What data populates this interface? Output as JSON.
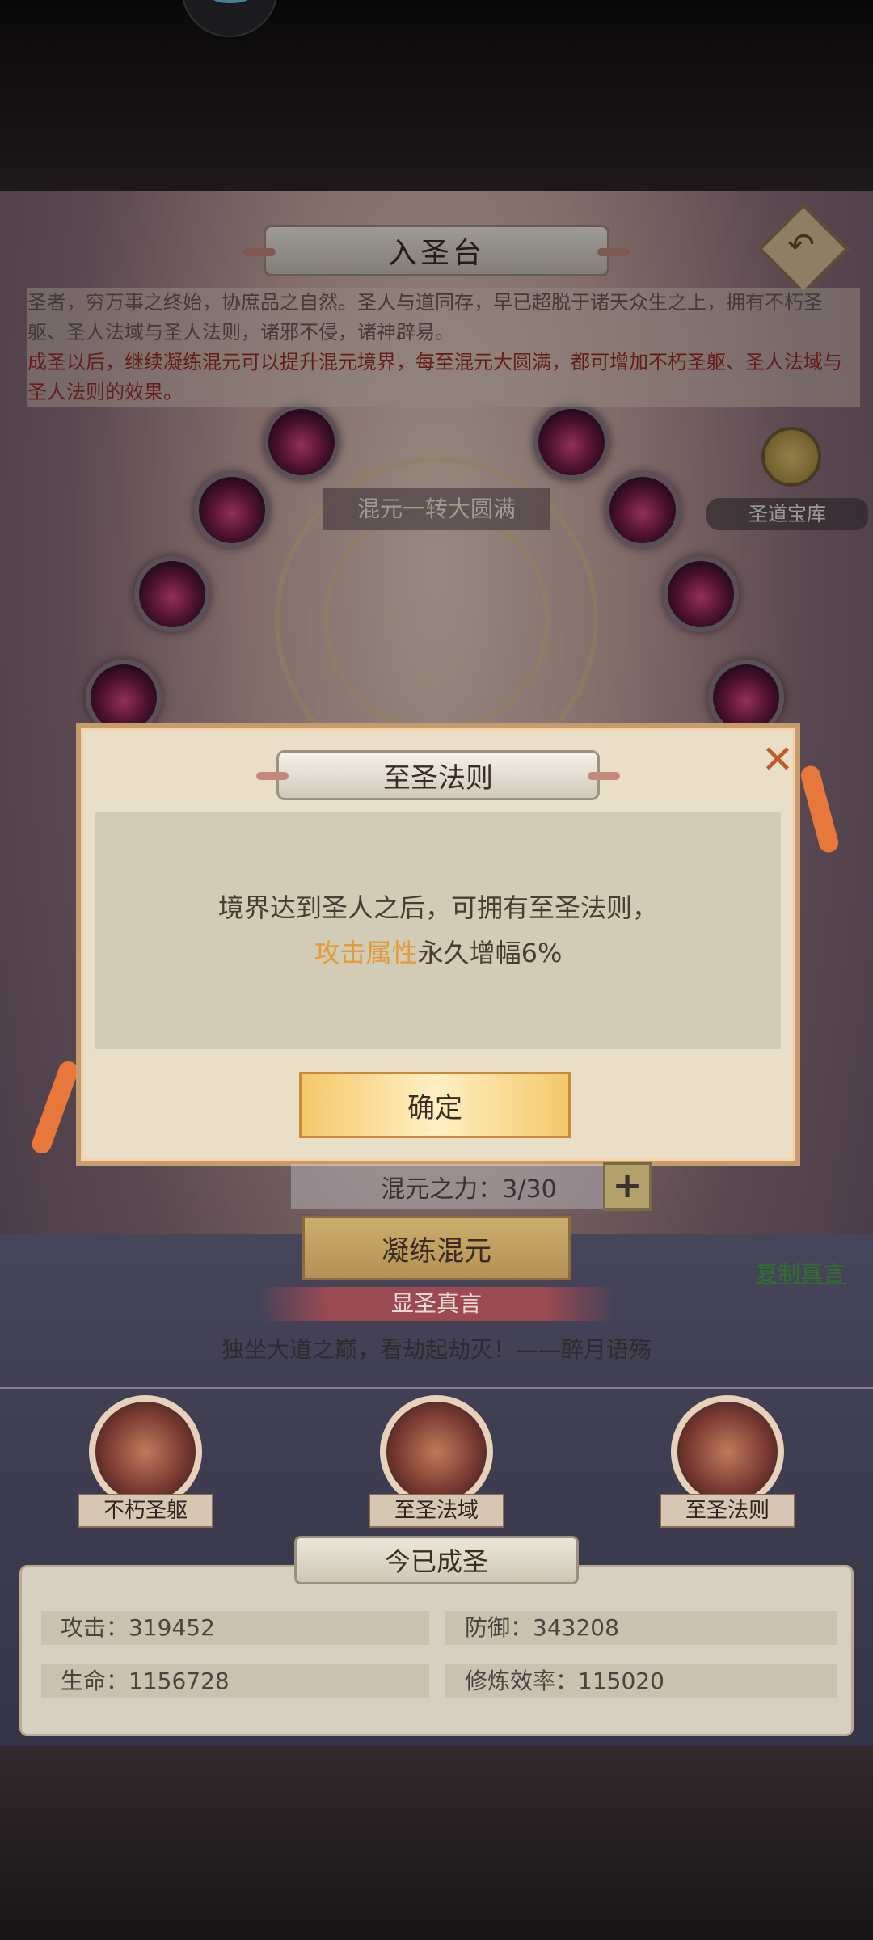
{
  "header": {
    "title": "入圣台",
    "back_icon": "back-arrow-icon"
  },
  "intro": {
    "line1": "圣者，穷万事之终始，协庶品之自然。圣人与道同存，早已超脱于诸天众生之上，拥有不朽圣躯、圣人法域与圣人法则，诸邪不侵，诸神辟易。",
    "line2": "成圣以后，继续凝练混元可以提升混元境界，每至混元大圆满，都可增加不朽圣躯、圣人法域与圣人法则的效果。"
  },
  "progress_label": "混元一转大圆满",
  "vault": {
    "label": "圣道宝库"
  },
  "dialog": {
    "title": "至圣法则",
    "body_line1": "境界达到圣人之后，可拥有至圣法则，",
    "body_highlight": "攻击属性",
    "body_line2_rest": "永久增幅6%",
    "confirm": "确定",
    "close_icon": "close-icon"
  },
  "power": {
    "label": "混元之力：3/30",
    "plus": "+"
  },
  "refine_button": "凝练混元",
  "copy_link": "复制真言",
  "truth": {
    "banner": "显圣真言",
    "quote": "独坐大道之巅，看劫起劫灭！——醉月语殇"
  },
  "skills": [
    {
      "label": "不朽圣躯"
    },
    {
      "label": "至圣法域"
    },
    {
      "label": "至圣法则"
    }
  ],
  "status_banner": "今已成圣",
  "stats": {
    "attack": "攻击：319452",
    "defense": "防御：343208",
    "hp": "生命：1156728",
    "efficiency": "修炼效率：115020"
  },
  "colors": {
    "highlight": "#e39a3a",
    "intro_red": "#9c2c28",
    "link_green": "#2f6f2f",
    "confirm_gold": "#f4c86a"
  }
}
